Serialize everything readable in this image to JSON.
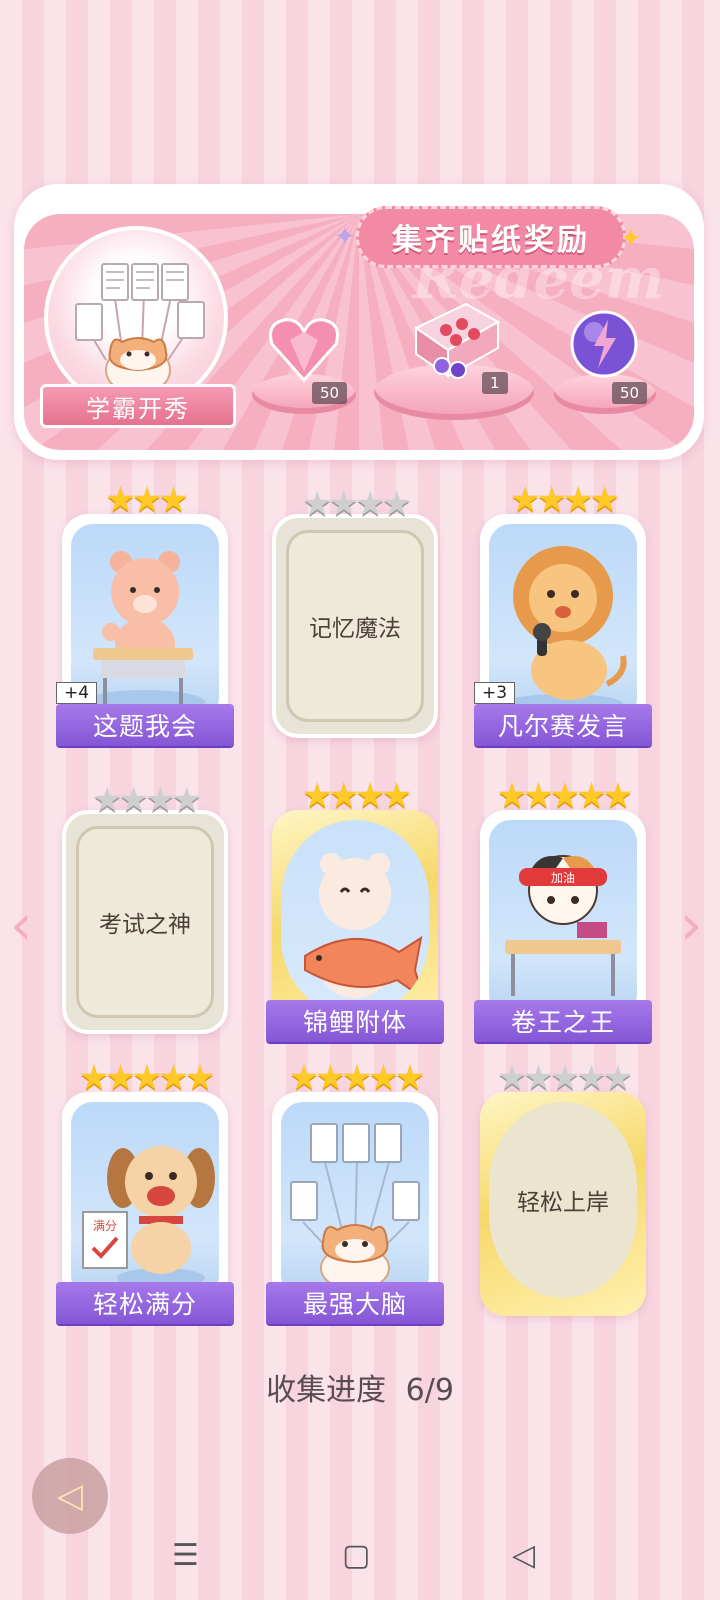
{
  "banner": {
    "title": "集齐贴纸奖励",
    "watermark": "Redeem",
    "theme_label": "学霸开秀",
    "rewards": [
      {
        "icon": "pink-diamond-heart-icon",
        "count": "50"
      },
      {
        "icon": "gift-box-icon",
        "count": "1"
      },
      {
        "icon": "purple-energy-orb-icon",
        "count": "50"
      }
    ]
  },
  "cards": [
    {
      "name": "这题我会",
      "stars_on": 3,
      "stars_total": 3,
      "plus": "+4",
      "locked": false,
      "art": "bear-at-desk"
    },
    {
      "name": "记忆魔法",
      "stars_on": 0,
      "stars_total": 4,
      "locked": true,
      "art": ""
    },
    {
      "name": "凡尔赛发言",
      "stars_on": 4,
      "stars_total": 4,
      "plus": "+3",
      "locked": false,
      "art": "lion-with-mic"
    },
    {
      "name": "考试之神",
      "stars_on": 0,
      "stars_total": 4,
      "locked": true,
      "art": ""
    },
    {
      "name": "锦鲤附体",
      "stars_on": 4,
      "stars_total": 4,
      "locked": false,
      "gold": true,
      "art": "bear-with-koi"
    },
    {
      "name": "卷王之王",
      "stars_on": 5,
      "stars_total": 5,
      "locked": false,
      "art": "cat-studying",
      "headband": "加油"
    },
    {
      "name": "轻松满分",
      "stars_on": 5,
      "stars_total": 5,
      "locked": false,
      "art": "dog-with-paper",
      "paper": "满分"
    },
    {
      "name": "最强大脑",
      "stars_on": 5,
      "stars_total": 5,
      "locked": false,
      "art": "cat-with-papers"
    },
    {
      "name": "轻松上岸",
      "stars_on": 0,
      "stars_total": 5,
      "locked": true,
      "gold": true,
      "art": ""
    }
  ],
  "progress": {
    "label": "收集进度",
    "value": "6/9"
  },
  "nav": {
    "menu": "☰",
    "home": "▢",
    "back": "◁"
  },
  "arrows": {
    "left": "‹",
    "right": "›"
  },
  "colors": {
    "accent": "#8456d6",
    "star": "#ffc928",
    "banner_pink": "#f28aa6"
  }
}
